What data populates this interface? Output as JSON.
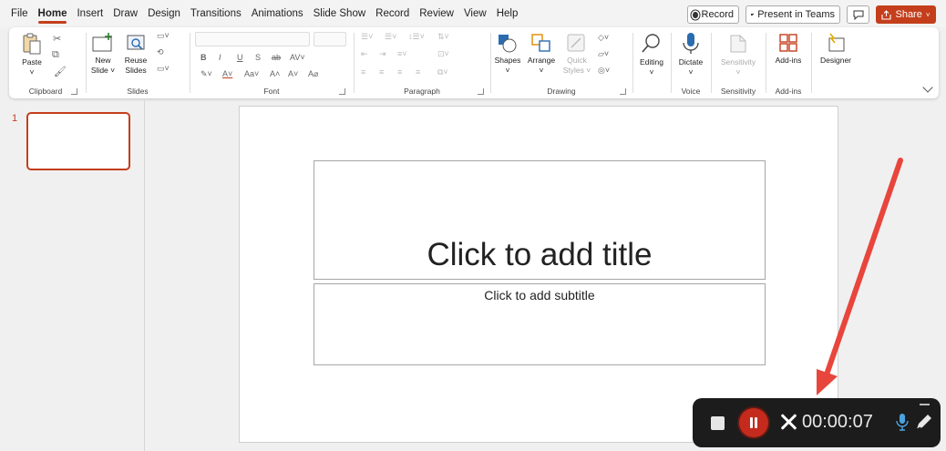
{
  "menu": {
    "tabs": [
      "File",
      "Home",
      "Insert",
      "Draw",
      "Design",
      "Transitions",
      "Animations",
      "Slide Show",
      "Record",
      "Review",
      "View",
      "Help"
    ],
    "active_tab": "Home",
    "record_label": "Record",
    "present_label": "Present in Teams",
    "share_label": "Share"
  },
  "ribbon": {
    "clipboard": {
      "paste": "Paste",
      "label": "Clipboard"
    },
    "slides": {
      "new_slide_1": "New",
      "new_slide_2": "Slide ˅",
      "reuse_1": "Reuse",
      "reuse_2": "Slides",
      "label": "Slides"
    },
    "font": {
      "label": "Font",
      "bold": "B",
      "italic": "I",
      "underline": "U",
      "strike": "S",
      "size_up": "A˄",
      "size_down": "A˅",
      "case": "Aa˅"
    },
    "paragraph": {
      "label": "Paragraph"
    },
    "drawing": {
      "shapes": "Shapes",
      "arrange": "Arrange",
      "quick_styles_1": "Quick",
      "quick_styles_2": "Styles ˅",
      "label": "Drawing"
    },
    "editing": {
      "label": "Editing"
    },
    "voice": {
      "dictate": "Dictate",
      "label": "Voice"
    },
    "sensitivity": {
      "button": "Sensitivity",
      "label": "Sensitivity"
    },
    "addins": {
      "button": "Add-ins",
      "label": "Add-ins"
    },
    "designer": {
      "button": "Designer"
    }
  },
  "thumbnails": {
    "slide_number": "1"
  },
  "slide": {
    "title_placeholder": "Click to add title",
    "subtitle_placeholder": "Click to add subtitle"
  },
  "recorder": {
    "time": "00:00:07"
  },
  "colors": {
    "accent": "#c43e1c",
    "arrow": "#e8453c",
    "recorder_bg": "#1c1c1c",
    "pause": "#c42b1c"
  }
}
